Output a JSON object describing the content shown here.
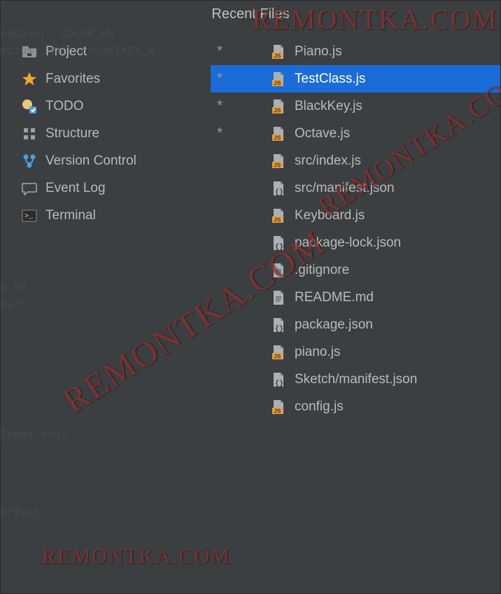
{
  "title": "Recent Files",
  "watermark": "REMONTKA.COM",
  "tools": [
    {
      "name": "project",
      "label": "Project",
      "icon": "folder"
    },
    {
      "name": "favorites",
      "label": "Favorites",
      "icon": "star"
    },
    {
      "name": "todo",
      "label": "TODO",
      "icon": "todo"
    },
    {
      "name": "structure",
      "label": "Structure",
      "icon": "structure"
    },
    {
      "name": "version-control",
      "label": "Version Control",
      "icon": "vcs"
    },
    {
      "name": "event-log",
      "label": "Event Log",
      "icon": "speech"
    },
    {
      "name": "terminal",
      "label": "Terminal",
      "icon": "terminal"
    }
  ],
  "files": [
    {
      "label": "Piano.js",
      "icon": "js",
      "modified": true,
      "selected": false
    },
    {
      "label": "TestClass.js",
      "icon": "js",
      "modified": true,
      "selected": true
    },
    {
      "label": "BlackKey.js",
      "icon": "js",
      "modified": true,
      "selected": false
    },
    {
      "label": "Octave.js",
      "icon": "js",
      "modified": true,
      "selected": false
    },
    {
      "label": "src/index.js",
      "icon": "js",
      "modified": false,
      "selected": false
    },
    {
      "label": "src/manifest.json",
      "icon": "json",
      "modified": false,
      "selected": false
    },
    {
      "label": "Keyboard.js",
      "icon": "js",
      "modified": false,
      "selected": false
    },
    {
      "label": "package-lock.json",
      "icon": "json",
      "modified": false,
      "selected": false
    },
    {
      "label": ".gitignore",
      "icon": "text",
      "modified": false,
      "selected": false
    },
    {
      "label": "README.md",
      "icon": "text",
      "modified": false,
      "selected": false
    },
    {
      "label": "package.json",
      "icon": "json",
      "modified": false,
      "selected": false
    },
    {
      "label": "piano.js",
      "icon": "js",
      "modified": false,
      "selected": false
    },
    {
      "label": "Sketch/manifest.json",
      "icon": "json",
      "modified": false,
      "selected": false
    },
    {
      "label": "config.js",
      "icon": "js",
      "modified": false,
      "selected": false
    }
  ]
}
